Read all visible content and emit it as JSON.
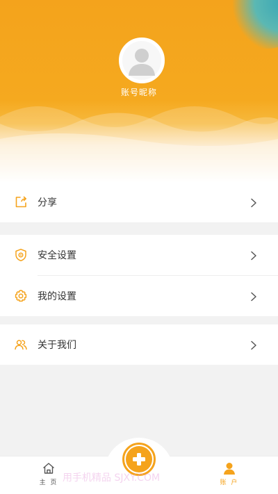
{
  "profile": {
    "nickname": "账号昵称",
    "avatar_icon": "user-avatar-icon"
  },
  "menu": {
    "group1": [
      {
        "label": "分享",
        "icon": "share-icon"
      }
    ],
    "group2": [
      {
        "label": "安全设置",
        "icon": "shield-icon"
      },
      {
        "label": "我的设置",
        "icon": "gear-icon"
      }
    ],
    "group3": [
      {
        "label": "关于我们",
        "icon": "people-icon"
      }
    ]
  },
  "tabbar": {
    "home_label": "主 页",
    "account_label": "账 户",
    "center_icon": "plus-icon"
  },
  "watermark": "用手机精品 SJXY.COM",
  "colors": {
    "accent": "#f5a31c",
    "background": "#f2f2f2"
  }
}
